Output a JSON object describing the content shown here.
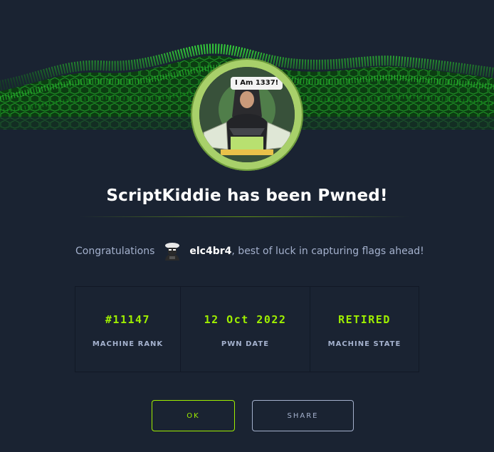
{
  "dialog": {
    "title": "ScriptKiddie has been Pwned!",
    "machine_avatar_caption": "I Am 1337!"
  },
  "congrats": {
    "label": "Congratulations",
    "username": "elc4br4",
    "message": ", best of luck in capturing flags ahead!"
  },
  "stats": [
    {
      "value": "#11147",
      "label": "MACHINE RANK"
    },
    {
      "value": "12 Oct 2022",
      "label": "PWN DATE"
    },
    {
      "value": "RETIRED",
      "label": "MACHINE STATE"
    }
  ],
  "buttons": {
    "ok": "OK",
    "share": "SHARE"
  },
  "colors": {
    "background": "#1a2332",
    "accent": "#9fef00",
    "muted_text": "#a4b1cd",
    "heading": "#ffffff"
  },
  "icons": {
    "banner": "green-wave-grid",
    "machine_avatar": "hooded-hacker-icon",
    "user_avatar": "user-avatar-icon"
  }
}
